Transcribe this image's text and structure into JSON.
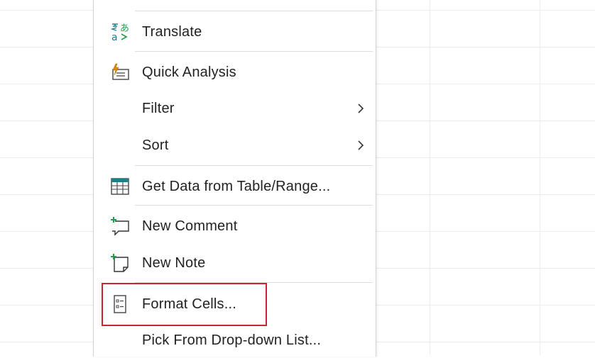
{
  "menu": {
    "items": [
      {
        "label": "Translate",
        "icon": "translate-icon"
      },
      {
        "label": "Quick Analysis",
        "icon": "quick-analysis-icon"
      },
      {
        "label": "Filter",
        "submenu": true
      },
      {
        "label": "Sort",
        "submenu": true
      },
      {
        "label": "Get Data from Table/Range...",
        "icon": "table-range-icon"
      },
      {
        "label": "New Comment",
        "icon": "new-comment-icon"
      },
      {
        "label": "New Note",
        "icon": "new-note-icon"
      },
      {
        "label": "Format Cells...",
        "icon": "format-cells-icon",
        "highlighted": true
      },
      {
        "label": "Pick From Drop-down List..."
      }
    ]
  },
  "colors": {
    "highlight_border": "#c8252c",
    "icon_teal": "#1f7f8c",
    "icon_green": "#1e9e4a",
    "icon_orange": "#e68a00"
  }
}
